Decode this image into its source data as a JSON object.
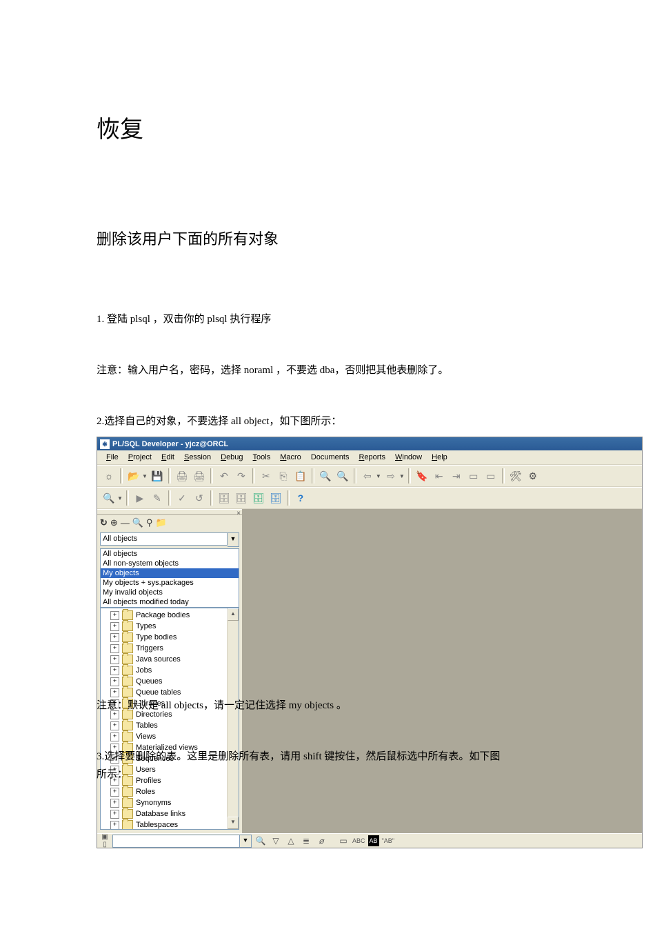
{
  "doc": {
    "title": "恢复",
    "subtitle": "删除该用户下面的所有对象",
    "para1": "1.    登陆 plsql ，双击你的 plsql 执行程序",
    "para2": "注意：输入用户名，密码，选择 noraml ，不要选 dba，否则把其他表删除了。",
    "para3": "2.选择自己的对象，不要选择 all object，如下图所示：",
    "overlay1": "注意：默认是 all objects，请一定记住选择 my objects 。",
    "overlay2": "3.选择要删除的表。这里是删除所有表，请用 shift 键按住，然后鼠标选中所有表。如下图",
    "overlay3": "所示："
  },
  "screenshot": {
    "title": "PL/SQL Developer - yjcz@ORCL",
    "menu": [
      "File",
      "Project",
      "Edit",
      "Session",
      "Debug",
      "Tools",
      "Macro",
      "Documents",
      "Reports",
      "Window",
      "Help"
    ],
    "menu_hk": [
      "F",
      "P",
      "E",
      "S",
      "D",
      "T",
      "M",
      "",
      "R",
      "W",
      "H"
    ],
    "filter_current": "All objects",
    "dropdown": [
      "All objects",
      "All non-system objects",
      "My objects",
      "My objects + sys.packages",
      "My invalid objects",
      "All objects modified today"
    ],
    "dropdown_selected_index": 2,
    "tree": [
      "Package bodies",
      "Types",
      "Type bodies",
      "Triggers",
      "Java sources",
      "Jobs",
      "Queues",
      "Queue tables",
      "Libraries",
      "Directories",
      "Tables",
      "Views",
      "Materialized views",
      "Sequences",
      "Users",
      "Profiles",
      "Roles",
      "Synonyms",
      "Database links",
      "Tablespaces"
    ],
    "bottom_icons_text": {
      "abc": "ABC",
      "ab_quoted": "\"AB\"",
      "ab_box": "AB"
    }
  }
}
